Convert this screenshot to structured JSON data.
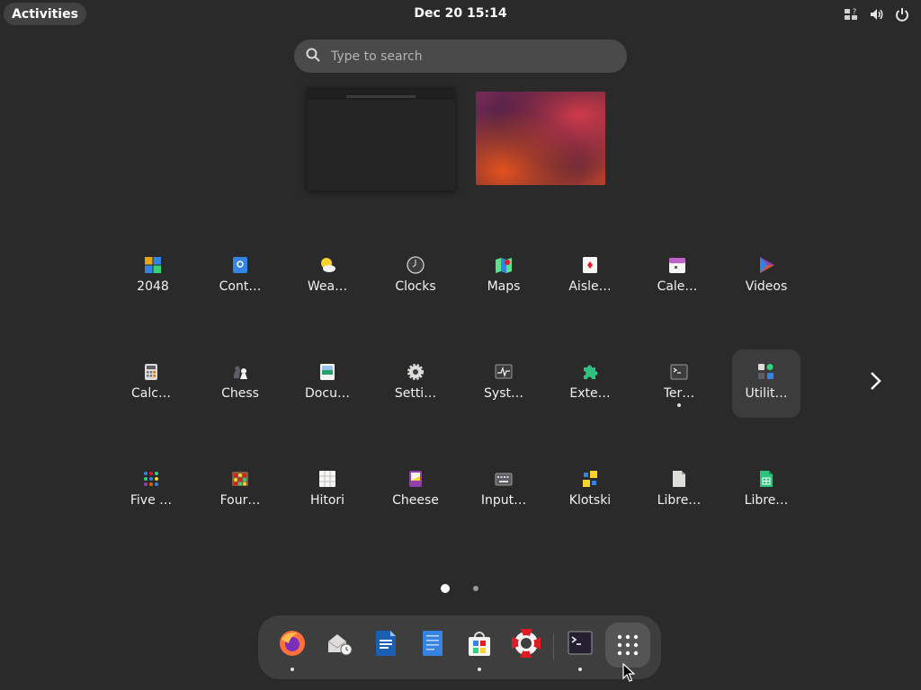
{
  "topbar": {
    "activities_label": "Activities",
    "clock": "Dec 20  15:14",
    "tray_icons": [
      "accessibility-icon",
      "volume-icon",
      "power-icon"
    ]
  },
  "search": {
    "placeholder": "Type to search"
  },
  "apps": [
    {
      "label": "2048",
      "icon": "2048-icon"
    },
    {
      "label": "Cont…",
      "icon": "contacts-icon"
    },
    {
      "label": "Wea…",
      "icon": "weather-icon"
    },
    {
      "label": "Clocks",
      "icon": "clocks-icon"
    },
    {
      "label": "Maps",
      "icon": "maps-icon"
    },
    {
      "label": "Aisle…",
      "icon": "aisleriot-icon"
    },
    {
      "label": "Cale…",
      "icon": "calendar-icon"
    },
    {
      "label": "Videos",
      "icon": "videos-icon"
    },
    {
      "label": "Calc…",
      "icon": "calculator-icon"
    },
    {
      "label": "Chess",
      "icon": "chess-icon"
    },
    {
      "label": "Docu…",
      "icon": "document-viewer-icon"
    },
    {
      "label": "Setti…",
      "icon": "settings-icon"
    },
    {
      "label": "Syst…",
      "icon": "system-monitor-icon"
    },
    {
      "label": "Exte…",
      "icon": "extensions-icon"
    },
    {
      "label": "Ter…",
      "icon": "terminal-icon",
      "running": true
    },
    {
      "label": "Utilit…",
      "icon": "utilities-folder-icon"
    },
    {
      "label": "Five …",
      "icon": "five-or-more-icon"
    },
    {
      "label": "Four…",
      "icon": "four-in-a-row-icon"
    },
    {
      "label": "Hitori",
      "icon": "hitori-icon"
    },
    {
      "label": "Cheese",
      "icon": "cheese-icon"
    },
    {
      "label": "Input…",
      "icon": "input-method-icon"
    },
    {
      "label": "Klotski",
      "icon": "klotski-icon"
    },
    {
      "label": "Libre…",
      "icon": "libreoffice-icon"
    },
    {
      "label": "Libre…",
      "icon": "libreoffice-calc-icon"
    }
  ],
  "pagination": {
    "current_page": 1,
    "total_pages": 2
  },
  "dock": [
    {
      "app": "firefox",
      "icon": "firefox-icon",
      "running": true
    },
    {
      "app": "evolution",
      "icon": "mail-clock-icon",
      "running": false
    },
    {
      "app": "libreoffice-writer",
      "icon": "writer-icon",
      "running": false
    },
    {
      "app": "text-editor",
      "icon": "text-editor-icon",
      "running": false
    },
    {
      "app": "software",
      "icon": "software-bag-icon",
      "running": true
    },
    {
      "app": "help",
      "icon": "help-lifebuoy-icon",
      "running": false
    },
    {
      "app": "terminal",
      "icon": "terminal-icon",
      "running": true
    },
    {
      "app": "show-apps",
      "icon": "app-grid-icon",
      "running": false
    }
  ],
  "colors": {
    "background": "#2a2a2a",
    "panel": "#424242",
    "dock": "#3e3e3e",
    "accent_blue": "#3584e4"
  }
}
